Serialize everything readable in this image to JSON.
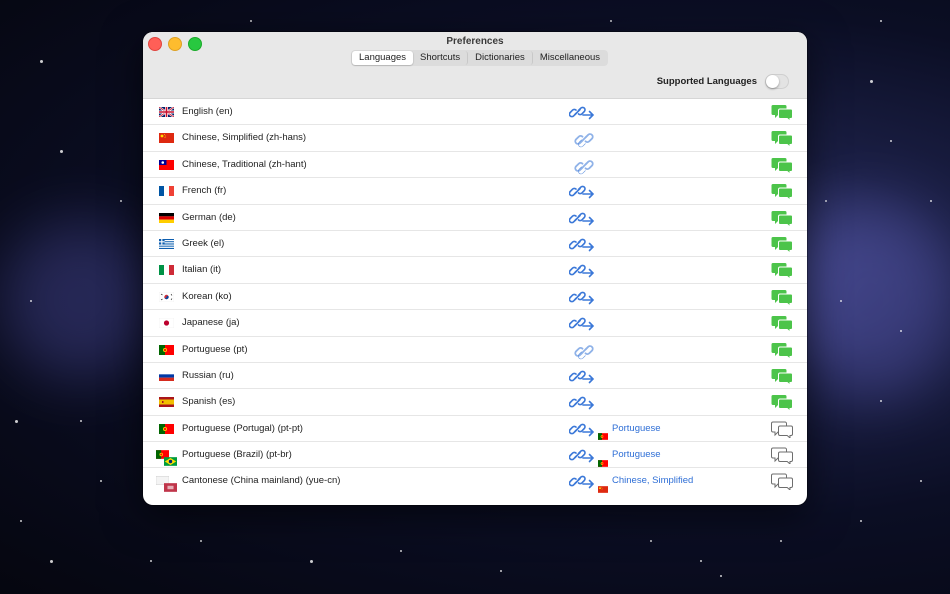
{
  "window": {
    "title": "Preferences",
    "tabs": [
      {
        "label": "Languages",
        "active": true
      },
      {
        "label": "Shortcuts",
        "active": false
      },
      {
        "label": "Dictionaries",
        "active": false
      },
      {
        "label": "Miscellaneous",
        "active": false
      }
    ],
    "supported_label": "Supported Languages",
    "supported_enabled": false
  },
  "languages": [
    {
      "name": "English (en)",
      "flag": "gb-flag",
      "link": "arrow",
      "chat": "active"
    },
    {
      "name": "Chinese, Simplified (zh-hans)",
      "flag": "cn-flag",
      "link": "plain",
      "chat": "active"
    },
    {
      "name": "Chinese, Traditional (zh-hant)",
      "flag": "tw-flag",
      "link": "plain",
      "chat": "active"
    },
    {
      "name": "French (fr)",
      "flag": "fr-flag",
      "link": "arrow",
      "chat": "active"
    },
    {
      "name": "German (de)",
      "flag": "de-flag",
      "link": "arrow",
      "chat": "active"
    },
    {
      "name": "Greek (el)",
      "flag": "gr-flag",
      "link": "arrow",
      "chat": "active"
    },
    {
      "name": "Italian (it)",
      "flag": "it-flag",
      "link": "arrow",
      "chat": "active"
    },
    {
      "name": "Korean (ko)",
      "flag": "kr-flag",
      "link": "arrow",
      "chat": "active"
    },
    {
      "name": "Japanese (ja)",
      "flag": "jp-flag",
      "link": "arrow",
      "chat": "active"
    },
    {
      "name": "Portuguese (pt)",
      "flag": "pt-flag",
      "link": "plain",
      "chat": "active"
    },
    {
      "name": "Russian (ru)",
      "flag": "ru-flag",
      "link": "arrow",
      "chat": "active"
    },
    {
      "name": "Spanish (es)",
      "flag": "es-flag",
      "link": "arrow",
      "chat": "active"
    },
    {
      "name": "Portuguese (Portugal) (pt-pt)",
      "flag": "pt-flag",
      "link": "arrow",
      "chat": "inactive",
      "target": "Portuguese",
      "target_flag": "pt-flag"
    },
    {
      "name": "Portuguese (Brazil) (pt-br)",
      "flag": "pt-br-flag",
      "link": "arrow",
      "chat": "inactive",
      "target": "Portuguese",
      "target_flag": "pt-flag"
    },
    {
      "name": "Cantonese (China mainland) (yue-cn)",
      "flag": "yue-cn-flag",
      "link": "arrow",
      "chat": "inactive",
      "target": "Chinese, Simplified",
      "target_flag": "cn-flag"
    }
  ],
  "colors": {
    "link_blue": "#3b78d8",
    "link_faded": "#8fb2e8",
    "chat_green": "#4cc44a",
    "chat_gray": "#6e6e6e"
  }
}
